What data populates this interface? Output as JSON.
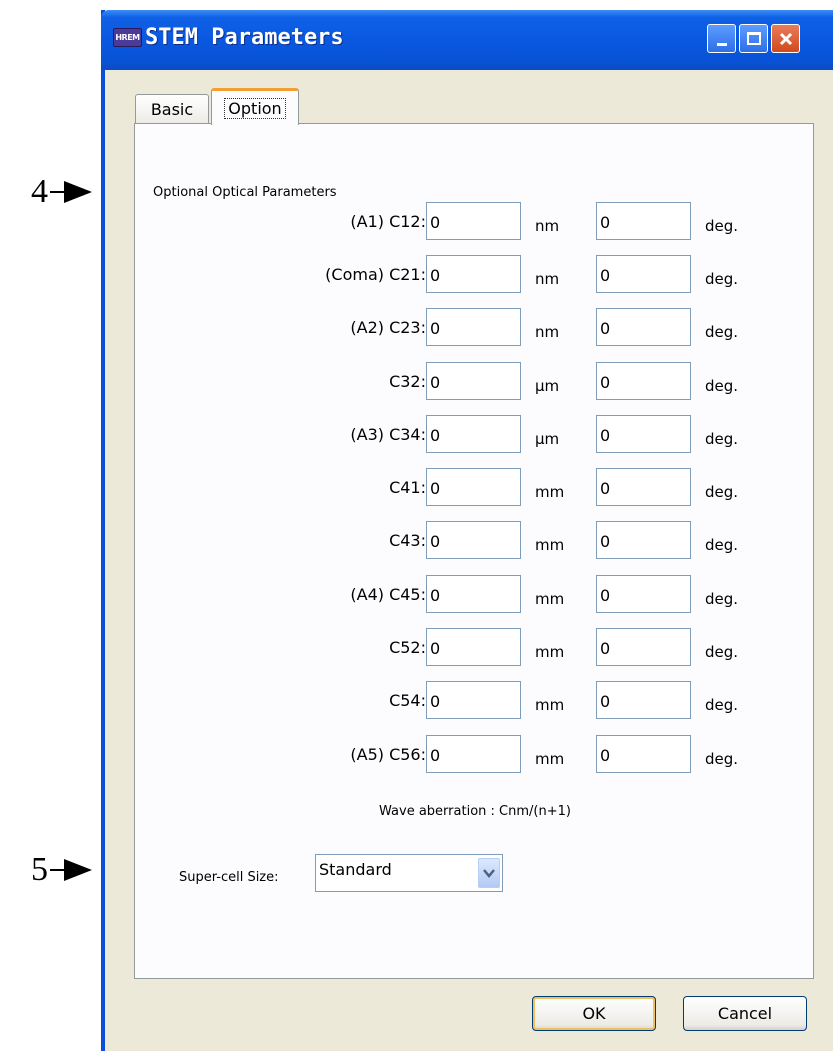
{
  "annotations": [
    {
      "number": "4",
      "points_to": "section-title"
    },
    {
      "number": "5",
      "points_to": "super-cell-size"
    }
  ],
  "window": {
    "app_badge": "HREM",
    "title": "STEM Parameters",
    "controls": [
      "minimize",
      "maximize",
      "close"
    ]
  },
  "tabs": [
    {
      "label": "Basic",
      "selected": false
    },
    {
      "label": "Option",
      "selected": true
    }
  ],
  "option": {
    "section_title": "Optional Optical Parameters",
    "rows": [
      {
        "label": "(A1) C12:",
        "value": "0",
        "unit": "nm",
        "angle": "0",
        "angle_unit": "deg."
      },
      {
        "label": "(Coma) C21:",
        "value": "0",
        "unit": "nm",
        "angle": "0",
        "angle_unit": "deg."
      },
      {
        "label": "(A2) C23:",
        "value": "0",
        "unit": "nm",
        "angle": "0",
        "angle_unit": "deg."
      },
      {
        "label": "C32:",
        "value": "0",
        "unit": "μm",
        "angle": "0",
        "angle_unit": "deg."
      },
      {
        "label": "(A3) C34:",
        "value": "0",
        "unit": "μm",
        "angle": "0",
        "angle_unit": "deg."
      },
      {
        "label": "C41:",
        "value": "0",
        "unit": "mm",
        "angle": "0",
        "angle_unit": "deg."
      },
      {
        "label": "C43:",
        "value": "0",
        "unit": "mm",
        "angle": "0",
        "angle_unit": "deg."
      },
      {
        "label": "(A4) C45:",
        "value": "0",
        "unit": "mm",
        "angle": "0",
        "angle_unit": "deg."
      },
      {
        "label": "C52:",
        "value": "0",
        "unit": "mm",
        "angle": "0",
        "angle_unit": "deg."
      },
      {
        "label": "C54:",
        "value": "0",
        "unit": "mm",
        "angle": "0",
        "angle_unit": "deg."
      },
      {
        "label": "(A5) C56:",
        "value": "0",
        "unit": "mm",
        "angle": "0",
        "angle_unit": "deg."
      }
    ],
    "wave_note": "Wave aberration : Cnm/(n+1)",
    "super_cell": {
      "label": "Super-cell Size:",
      "value": "Standard"
    }
  },
  "buttons": {
    "ok": "OK",
    "cancel": "Cancel"
  },
  "colors": {
    "titlebar": "#0a58e0",
    "window_bg": "#ece9d8",
    "panel_bg": "#fcfcfe",
    "selected_tab_accent": "#f2a036",
    "field_border": "#7f9db9",
    "close_button": "#d04a1c"
  }
}
